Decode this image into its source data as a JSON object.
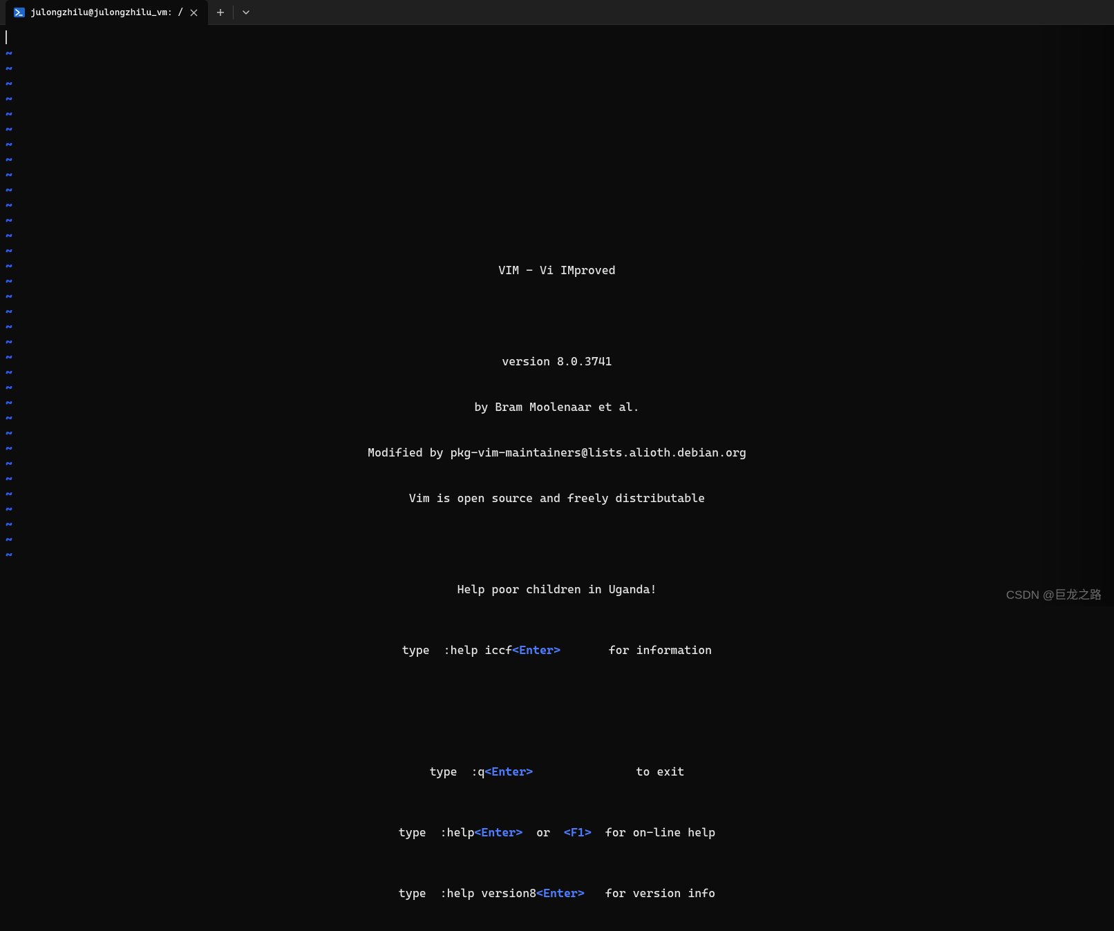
{
  "titlebar": {
    "tabs": [
      {
        "icon": "powershell-icon",
        "title": "julongzhilu@julongzhilu_vm: /"
      }
    ],
    "newTab": "+",
    "dropdown": "⌄"
  },
  "terminal": {
    "tildeColor": "#2a60ff",
    "tildeGlyph": "~",
    "tildeCount": 34
  },
  "vim": {
    "title": "VIM - Vi IMproved",
    "version": "version 8.0.3741",
    "author": "by Bram Moolenaar et al.",
    "modified": "Modified by pkg-vim-maintainers@lists.alioth.debian.org",
    "license": "Vim is open source and freely distributable",
    "charity": "Help poor children in Uganda!",
    "help_iccf_pre": "type  :help iccf",
    "help_iccf_key": "<Enter>",
    "help_iccf_post": "       for information",
    "quit_pre": "type  :q",
    "quit_key": "<Enter>",
    "quit_post": "               to exit",
    "help_pre": "type  :help",
    "help_key": "<Enter>",
    "help_mid": "  or  ",
    "help_f1": "<F1>",
    "help_post": "  for on-line help",
    "ver_pre": "type  :help version8",
    "ver_key": "<Enter>",
    "ver_post": "   for version info"
  },
  "watermark": "CSDN @巨龙之路"
}
